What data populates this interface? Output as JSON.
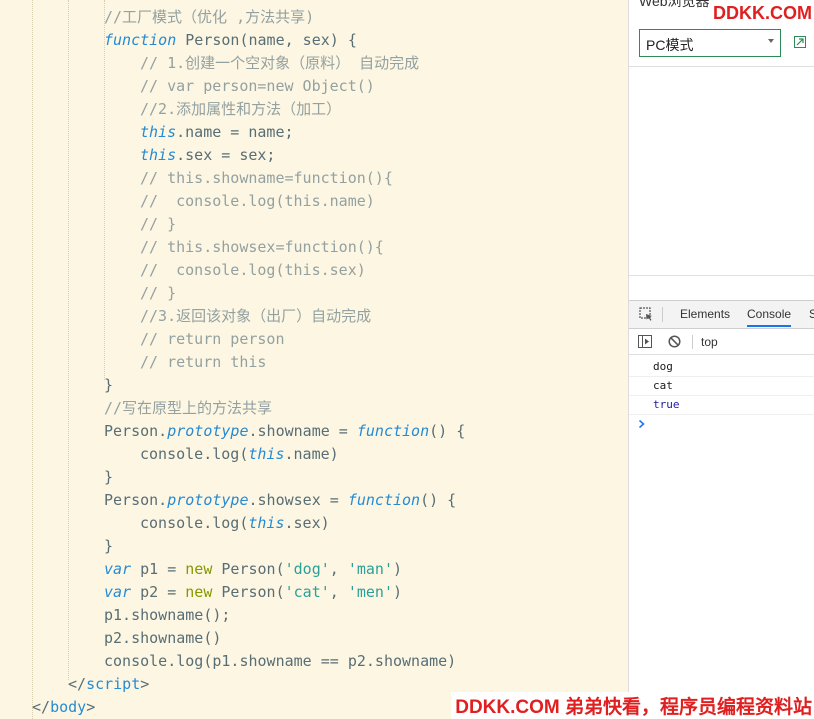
{
  "editor": {
    "lines": [
      [
        {
          "t": "//工厂模式（优化 ,方法共享)",
          "c": "c"
        }
      ],
      [
        {
          "t": "function",
          "c": "k"
        },
        {
          "t": " Person(name, sex) {",
          "c": "id"
        }
      ],
      [
        {
          "t": "// 1.创建一个空对象（原料） 自动完成",
          "c": "c"
        }
      ],
      [
        {
          "t": "// var person=new Object()",
          "c": "c"
        }
      ],
      [
        {
          "t": "//2.添加属性和方法（加工）",
          "c": "c"
        }
      ],
      [
        {
          "t": "this",
          "c": "k"
        },
        {
          "t": ".name = name;",
          "c": "id"
        }
      ],
      [
        {
          "t": "this",
          "c": "k"
        },
        {
          "t": ".sex = sex;",
          "c": "id"
        }
      ],
      [
        {
          "t": "// this.showname=function(){",
          "c": "c"
        }
      ],
      [
        {
          "t": "//  console.log(this.name)",
          "c": "c"
        }
      ],
      [
        {
          "t": "// }",
          "c": "c"
        }
      ],
      [
        {
          "t": "// this.showsex=function(){",
          "c": "c"
        }
      ],
      [
        {
          "t": "//  console.log(this.sex)",
          "c": "c"
        }
      ],
      [
        {
          "t": "// }",
          "c": "c"
        }
      ],
      [
        {
          "t": "//3.返回该对象（出厂）自动完成",
          "c": "c"
        }
      ],
      [
        {
          "t": "// return person",
          "c": "c"
        }
      ],
      [
        {
          "t": "// return this",
          "c": "c"
        }
      ],
      [
        {
          "t": "}",
          "c": "id"
        }
      ],
      [
        {
          "t": "//写在原型上的方法共享",
          "c": "c"
        }
      ],
      [
        {
          "t": "Person.",
          "c": "id"
        },
        {
          "t": "prototype",
          "c": "p"
        },
        {
          "t": ".showname = ",
          "c": "id"
        },
        {
          "t": "function",
          "c": "k"
        },
        {
          "t": "() {",
          "c": "id"
        }
      ],
      [
        {
          "t": "console.log(",
          "c": "id"
        },
        {
          "t": "this",
          "c": "k"
        },
        {
          "t": ".name)",
          "c": "id"
        }
      ],
      [
        {
          "t": "}",
          "c": "id"
        }
      ],
      [
        {
          "t": "Person.",
          "c": "id"
        },
        {
          "t": "prototype",
          "c": "p"
        },
        {
          "t": ".showsex = ",
          "c": "id"
        },
        {
          "t": "function",
          "c": "k"
        },
        {
          "t": "() {",
          "c": "id"
        }
      ],
      [
        {
          "t": "console.log(",
          "c": "id"
        },
        {
          "t": "this",
          "c": "k"
        },
        {
          "t": ".sex)",
          "c": "id"
        }
      ],
      [
        {
          "t": "}",
          "c": "id"
        }
      ],
      [
        {
          "t": "var",
          "c": "k"
        },
        {
          "t": " p1 = ",
          "c": "id"
        },
        {
          "t": "new",
          "c": "n"
        },
        {
          "t": " Person(",
          "c": "id"
        },
        {
          "t": "'dog'",
          "c": "s"
        },
        {
          "t": ", ",
          "c": "id"
        },
        {
          "t": "'man'",
          "c": "s"
        },
        {
          "t": ")",
          "c": "id"
        }
      ],
      [
        {
          "t": "var",
          "c": "k"
        },
        {
          "t": " p2 = ",
          "c": "id"
        },
        {
          "t": "new",
          "c": "n"
        },
        {
          "t": " Person(",
          "c": "id"
        },
        {
          "t": "'cat'",
          "c": "s"
        },
        {
          "t": ", ",
          "c": "id"
        },
        {
          "t": "'men'",
          "c": "s"
        },
        {
          "t": ")",
          "c": "id"
        }
      ],
      [
        {
          "t": "p1.showname();",
          "c": "id"
        }
      ],
      [
        {
          "t": "p2.showname()",
          "c": "id"
        }
      ],
      [
        {
          "t": "console.log(p1.showname == p2.showname)",
          "c": "id"
        }
      ],
      [
        {
          "t": "</",
          "c": "id"
        },
        {
          "t": "script",
          "c": "t"
        },
        {
          "t": ">",
          "c": "id"
        }
      ],
      [
        {
          "t": "</",
          "c": "id"
        },
        {
          "t": "body",
          "c": "t"
        },
        {
          "t": ">",
          "c": "id"
        }
      ]
    ],
    "indents": [
      1,
      1,
      2,
      2,
      2,
      2,
      2,
      2,
      2,
      2,
      2,
      2,
      2,
      2,
      2,
      2,
      1,
      1,
      1,
      2,
      1,
      1,
      2,
      1,
      1,
      1,
      1,
      1,
      1,
      0,
      -1
    ]
  },
  "browser": {
    "title": "Web浏览器",
    "brand": "DDKK.COM",
    "mode_selected": "PC模式"
  },
  "devtools": {
    "tabs": [
      "Elements",
      "Console",
      "S"
    ],
    "active_tab": "Console",
    "context": "top",
    "logs": [
      {
        "text": "dog",
        "color": "#1a1a1a"
      },
      {
        "text": "cat",
        "color": "#1a1a1a"
      },
      {
        "text": "true",
        "color": "#1a1aa6"
      }
    ]
  },
  "watermark": "DDKK.COM 弟弟快看，程序员编程资料站",
  "colors": {
    "editor_bg": "#fdf6e3",
    "keyword": "#268bd2",
    "string": "#2aa198",
    "comment": "#93a1a1",
    "accent": "#e02020"
  }
}
